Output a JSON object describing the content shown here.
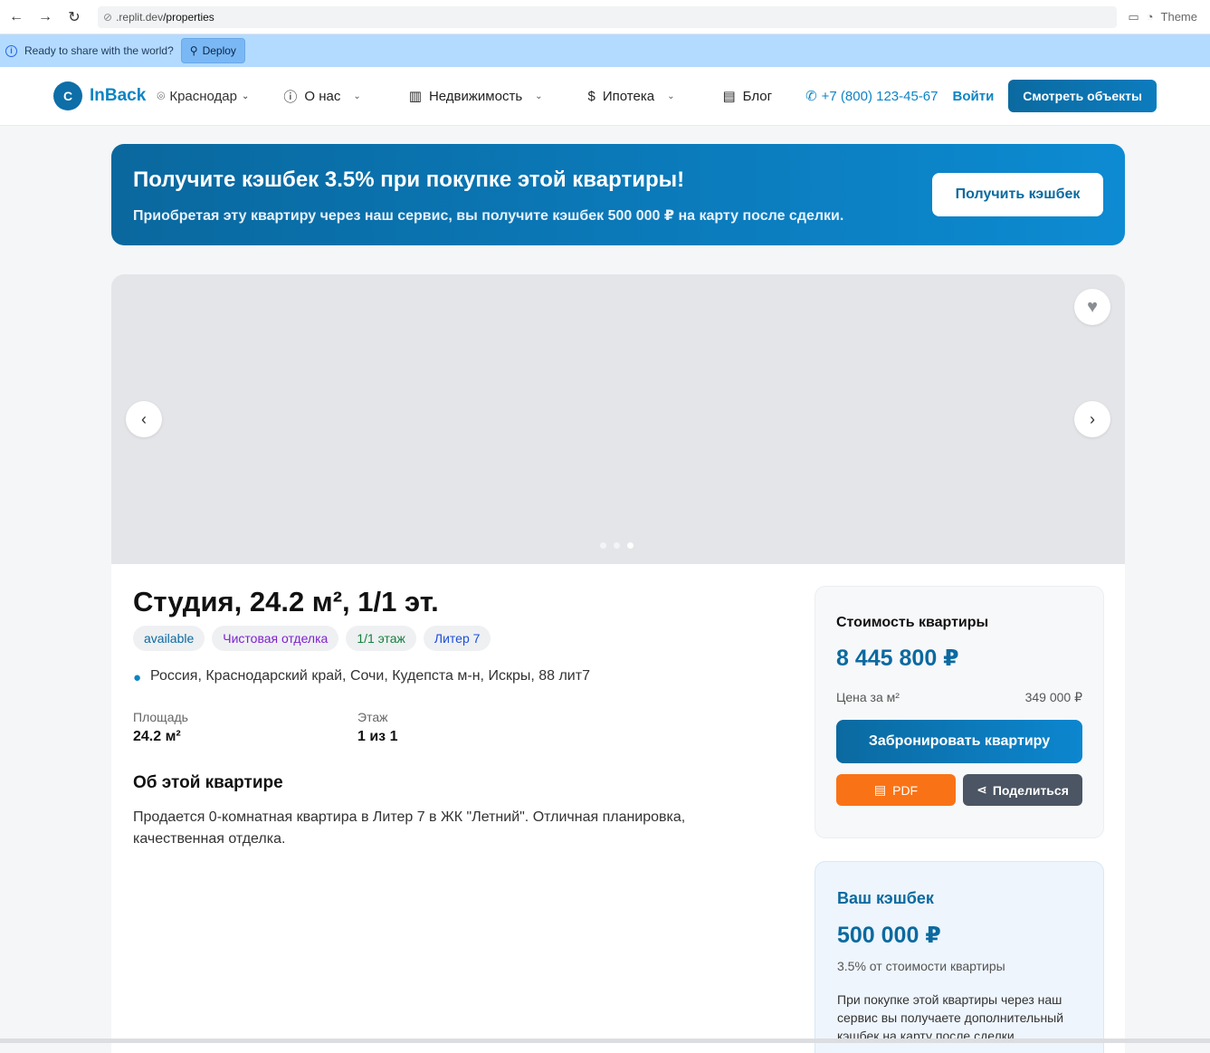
{
  "browser": {
    "url_host": ".replit.dev",
    "url_path": "/properties",
    "theme_label": "Theme"
  },
  "replit": {
    "share_text": "Ready to share with the world?",
    "deploy_label": "Deploy"
  },
  "header": {
    "logo_letter": "C",
    "logo_text": "InBack",
    "city": "Краснодар",
    "menu": [
      {
        "label": "О нас"
      },
      {
        "label": "Недвижимость"
      },
      {
        "label": "Ипотека"
      },
      {
        "label": "Блог"
      }
    ],
    "phone": "+7 (800) 123-45-67",
    "login": "Войти",
    "cta": "Смотреть объекты"
  },
  "banner": {
    "title": "Получите кэшбек 3.5% при покупке этой квартиры!",
    "text": "Приобретая эту квартиру через наш сервис, вы получите кэшбек 500 000 ₽ на карту после сделки.",
    "button": "Получить кэшбек"
  },
  "listing": {
    "title": "Студия, 24.2 м², 1/1 эт.",
    "tags": [
      {
        "label": "available",
        "bg": "#eef0f2",
        "color": "#0b6aa0"
      },
      {
        "label": "Чистовая отделка",
        "bg": "#eef0f2",
        "color": "#7e22ce"
      },
      {
        "label": "1/1 этаж",
        "bg": "#eef0f2",
        "color": "#15803d"
      },
      {
        "label": "Литер 7",
        "bg": "#eef0f2",
        "color": "#1d4ed8"
      }
    ],
    "address": "Россия, Краснодарский край, Сочи, Кудепста м-н, Искры, 88 лит7",
    "area_label": "Площадь",
    "area_value": "24.2 м²",
    "floor_label": "Этаж",
    "floor_value": "1 из 1",
    "about_title": "Об этой квартире",
    "about_text": "Продается 0-комнатная квартира в Литер 7 в ЖК \"Летний\". Отличная планировка, качественная отделка.",
    "gallery_slides": 3,
    "gallery_active": 3
  },
  "price": {
    "heading": "Стоимость квартиры",
    "value": "8 445 800 ₽",
    "per_m2_label": "Цена за м²",
    "per_m2_value": "349 000 ₽",
    "book_button": "Забронировать квартиру",
    "pdf_button": "PDF",
    "share_button": "Поделиться"
  },
  "cashback": {
    "heading": "Ваш кэшбек",
    "amount": "500 000 ₽",
    "percent_text": "3.5% от стоимости квартиры",
    "description": "При покупке этой квартиры через наш сервис вы получаете дополнительный кэшбек на карту после сделки."
  }
}
